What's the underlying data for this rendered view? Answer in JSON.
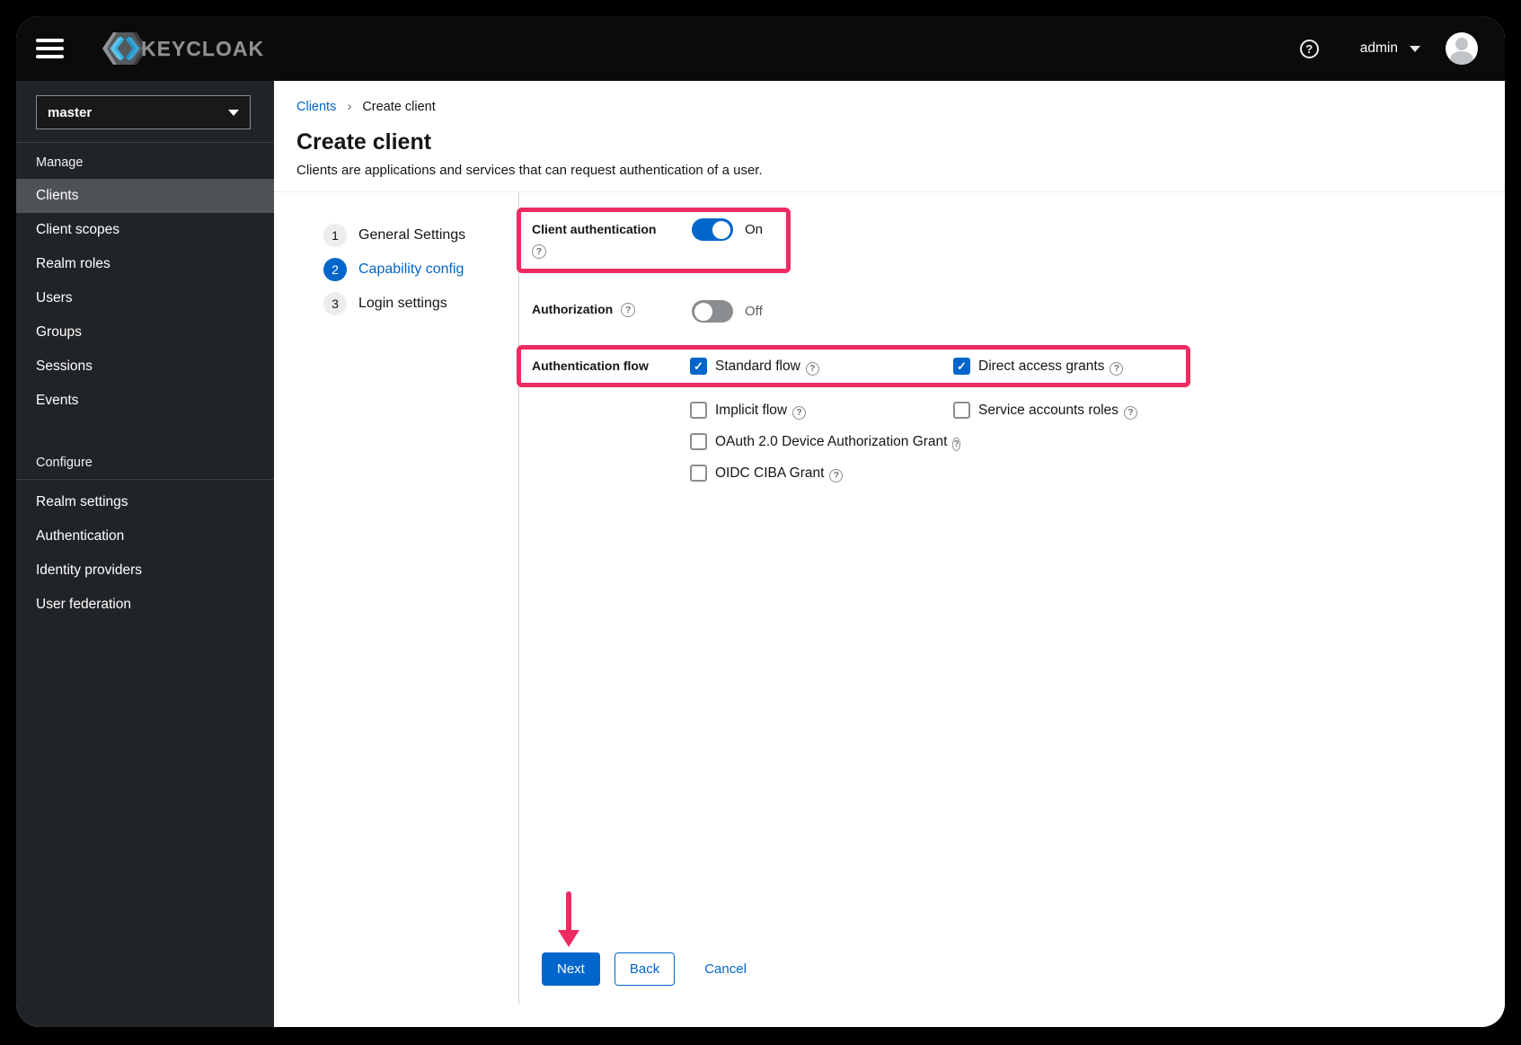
{
  "header": {
    "brand": "KEYCLOAK",
    "help_symbol": "?",
    "username": "admin"
  },
  "sidebar": {
    "realm": "master",
    "manage": {
      "title": "Manage",
      "items": [
        {
          "label": "Clients",
          "active": true
        },
        {
          "label": "Client scopes",
          "active": false
        },
        {
          "label": "Realm roles",
          "active": false
        },
        {
          "label": "Users",
          "active": false
        },
        {
          "label": "Groups",
          "active": false
        },
        {
          "label": "Sessions",
          "active": false
        },
        {
          "label": "Events",
          "active": false
        }
      ]
    },
    "configure": {
      "title": "Configure",
      "items": [
        {
          "label": "Realm settings",
          "active": false
        },
        {
          "label": "Authentication",
          "active": false
        },
        {
          "label": "Identity providers",
          "active": false
        },
        {
          "label": "User federation",
          "active": false
        }
      ]
    }
  },
  "breadcrumb": {
    "link": "Clients",
    "separator": "›",
    "current": "Create client"
  },
  "page": {
    "title": "Create client",
    "subtitle": "Clients are applications and services that can request authentication of a user."
  },
  "wizard": {
    "steps": [
      {
        "num": "1",
        "label": "General Settings",
        "active": false
      },
      {
        "num": "2",
        "label": "Capability config",
        "active": true
      },
      {
        "num": "3",
        "label": "Login settings",
        "active": false
      }
    ]
  },
  "form": {
    "client_authentication": {
      "label": "Client authentication",
      "value": "On",
      "enabled": true,
      "help": "?"
    },
    "authorization": {
      "label": "Authorization",
      "value": "Off",
      "enabled": false,
      "help": "?"
    },
    "authentication_flow": {
      "label": "Authentication flow",
      "options": [
        {
          "label": "Standard flow",
          "checked": true
        },
        {
          "label": "Direct access grants",
          "checked": true
        },
        {
          "label": "Implicit flow",
          "checked": false
        },
        {
          "label": "Service accounts roles",
          "checked": false
        },
        {
          "label": "OAuth 2.0 Device Authorization Grant",
          "checked": false
        },
        {
          "label": "OIDC CIBA Grant",
          "checked": false
        }
      ]
    }
  },
  "footer": {
    "next": "Next",
    "back": "Back",
    "cancel": "Cancel"
  },
  "colors": {
    "accent_blue": "#0066cc",
    "annotation_pink": "#ee2b62"
  }
}
